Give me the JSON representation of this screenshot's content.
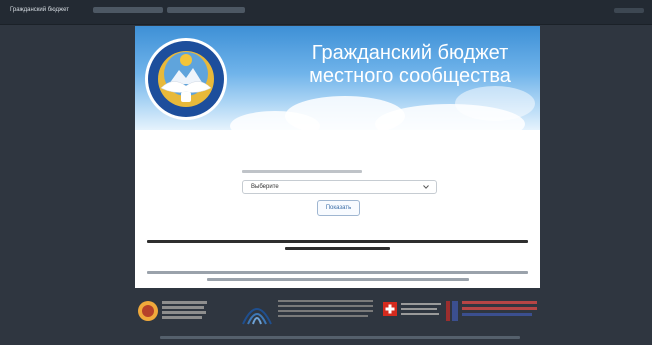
{
  "navbar": {
    "brand": "Гражданский бюджет"
  },
  "banner": {
    "title_line1": "Гражданский бюджет",
    "title_line2": "местного сообщества"
  },
  "form": {
    "select_value": "Выберите",
    "show_button": "Показать"
  }
}
